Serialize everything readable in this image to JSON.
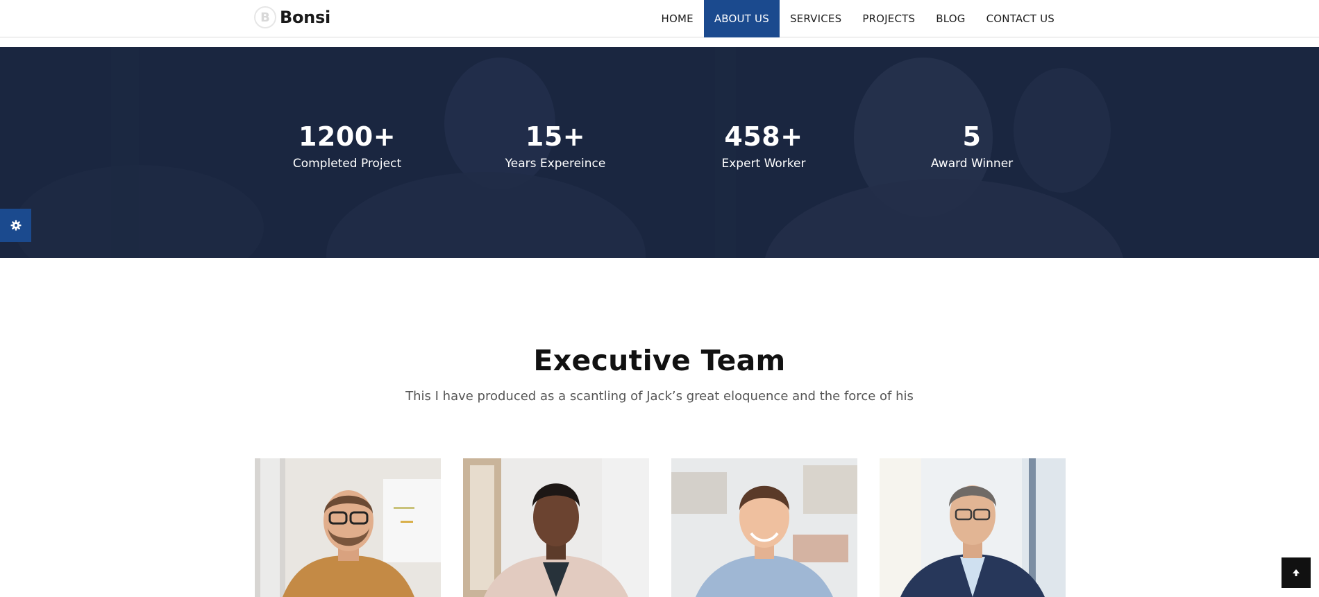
{
  "brand": {
    "logo_letter": "B",
    "name": "Bonsi",
    "accent_color": "#1b4a8e"
  },
  "nav": {
    "items": [
      {
        "label": "HOME",
        "active": false
      },
      {
        "label": "ABOUT US",
        "active": true
      },
      {
        "label": "SERVICES",
        "active": false
      },
      {
        "label": "PROJECTS",
        "active": false
      },
      {
        "label": "BLOG",
        "active": false
      },
      {
        "label": "CONTACT US",
        "active": false
      }
    ]
  },
  "stats": {
    "background_color": "#1a2640",
    "items": [
      {
        "value": "1200+",
        "label": "Completed Project"
      },
      {
        "value": "15+",
        "label": "Years Expereince"
      },
      {
        "value": "458+",
        "label": "Expert Worker"
      },
      {
        "value": "5",
        "label": "Award Winner"
      }
    ]
  },
  "team": {
    "title": "Executive Team",
    "subtitle": "This I have produced as a scantling of Jack’s great eloquence and the force of his",
    "members": [
      {
        "photo": "man-glasses-beard-orange-shirt"
      },
      {
        "photo": "woman-blazer"
      },
      {
        "photo": "man-light-blue-shirt"
      },
      {
        "photo": "man-glasses-navy-suit"
      }
    ]
  },
  "widgets": {
    "settings_icon": "gear-icon",
    "scroll_top_icon": "arrow-up-icon"
  }
}
